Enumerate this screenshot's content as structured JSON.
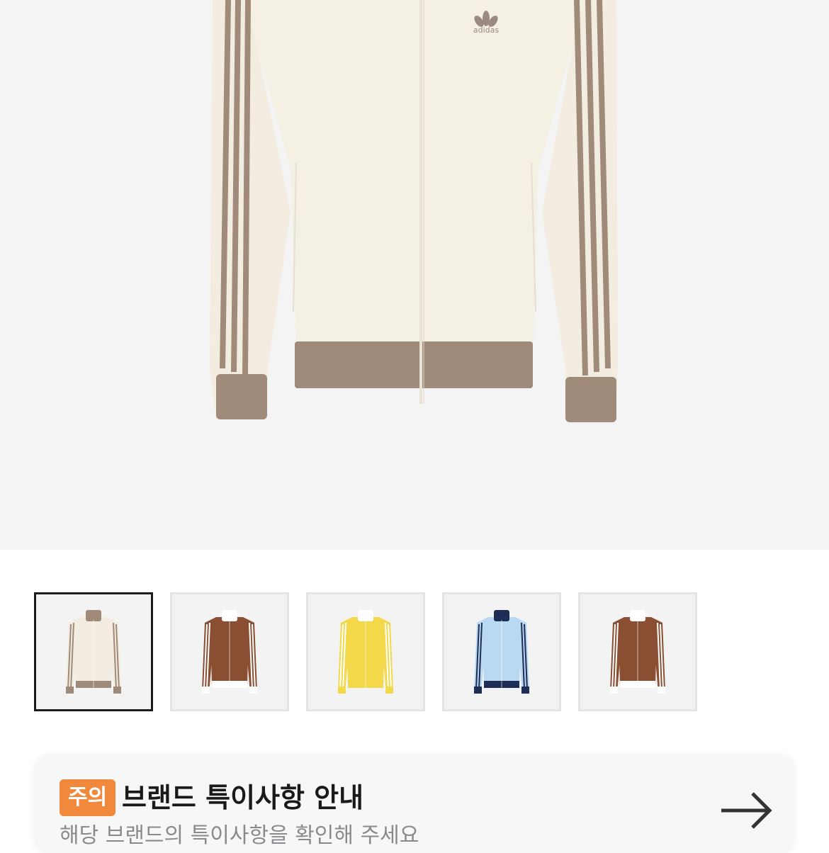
{
  "hero": {
    "image": "cream track jacket with taupe stripes",
    "logo_text": "adidas"
  },
  "thumbnails": [
    {
      "color_name": "cream/taupe",
      "body": "#f2ede0",
      "stripe": "#a08a7a",
      "collar": "#a08a7a",
      "cuff": "#a08a7a",
      "selected": true
    },
    {
      "color_name": "brown/white",
      "body": "#8a4f32",
      "stripe": "#ffffff",
      "collar": "#ffffff",
      "cuff": "#ffffff",
      "selected": false
    },
    {
      "color_name": "yellow/white",
      "body": "#f3d84a",
      "stripe": "#ffffff",
      "collar": "#ffffff",
      "cuff": "#f3d84a",
      "selected": false
    },
    {
      "color_name": "light blue/navy",
      "body": "#b9d9f2",
      "stripe": "#1e2d56",
      "collar": "#1e2d56",
      "cuff": "#1e2d56",
      "selected": false
    },
    {
      "color_name": "brown/white",
      "body": "#8a4f32",
      "stripe": "#ffffff",
      "collar": "#ffffff",
      "cuff": "#ffffff",
      "selected": false
    }
  ],
  "notice": {
    "badge": "주의",
    "title": "브랜드 특이사항 안내",
    "subtitle": "해당 브랜드의 특이사항을 확인해 주세요",
    "arrow_icon": "arrow-right-icon"
  },
  "colors": {
    "badge_bg": "#f0893b",
    "hero_bg": "#f4f4f5"
  }
}
